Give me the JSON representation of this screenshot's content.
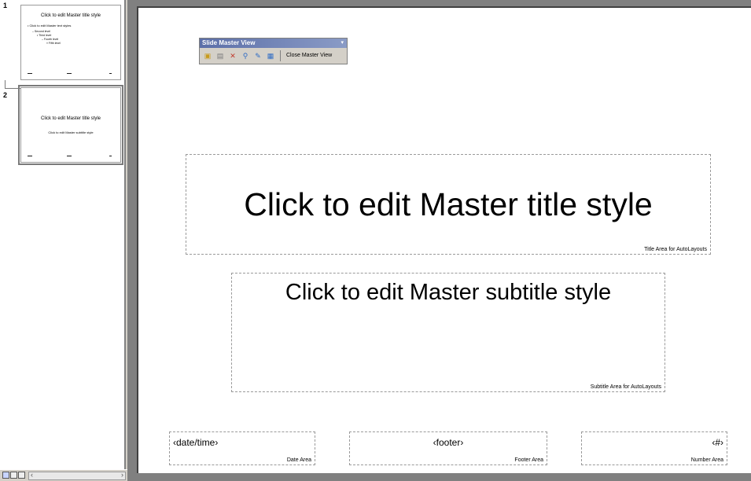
{
  "thumbnails": [
    {
      "number": "1",
      "title": "Click to edit Master title style",
      "lines": [
        "• Click to edit Master text styles",
        "– Second level",
        "• Third level",
        "– Fourth level",
        "» Fifth level"
      ]
    },
    {
      "number": "2",
      "title": "Click to edit Master title style",
      "subtitle": "Click to edit Master subtitle style"
    }
  ],
  "toolbar": {
    "title": "Slide Master View",
    "close_label": "Close Master View",
    "dropdown_icon": "▾"
  },
  "slide": {
    "title_text": "Click to edit Master title style",
    "title_area_label": "Title Area for AutoLayouts",
    "subtitle_text": "Click to edit Master subtitle style",
    "subtitle_area_label": "Subtitle Area for AutoLayouts",
    "date_text": "‹date/time›",
    "date_area_label": "Date Area",
    "footer_text": "‹footer›",
    "footer_area_label": "Footer Area",
    "number_text": "‹#›",
    "number_area_label": "Number Area"
  },
  "view_bar": {
    "scroll_left": "‹",
    "scroll_right": "›"
  }
}
